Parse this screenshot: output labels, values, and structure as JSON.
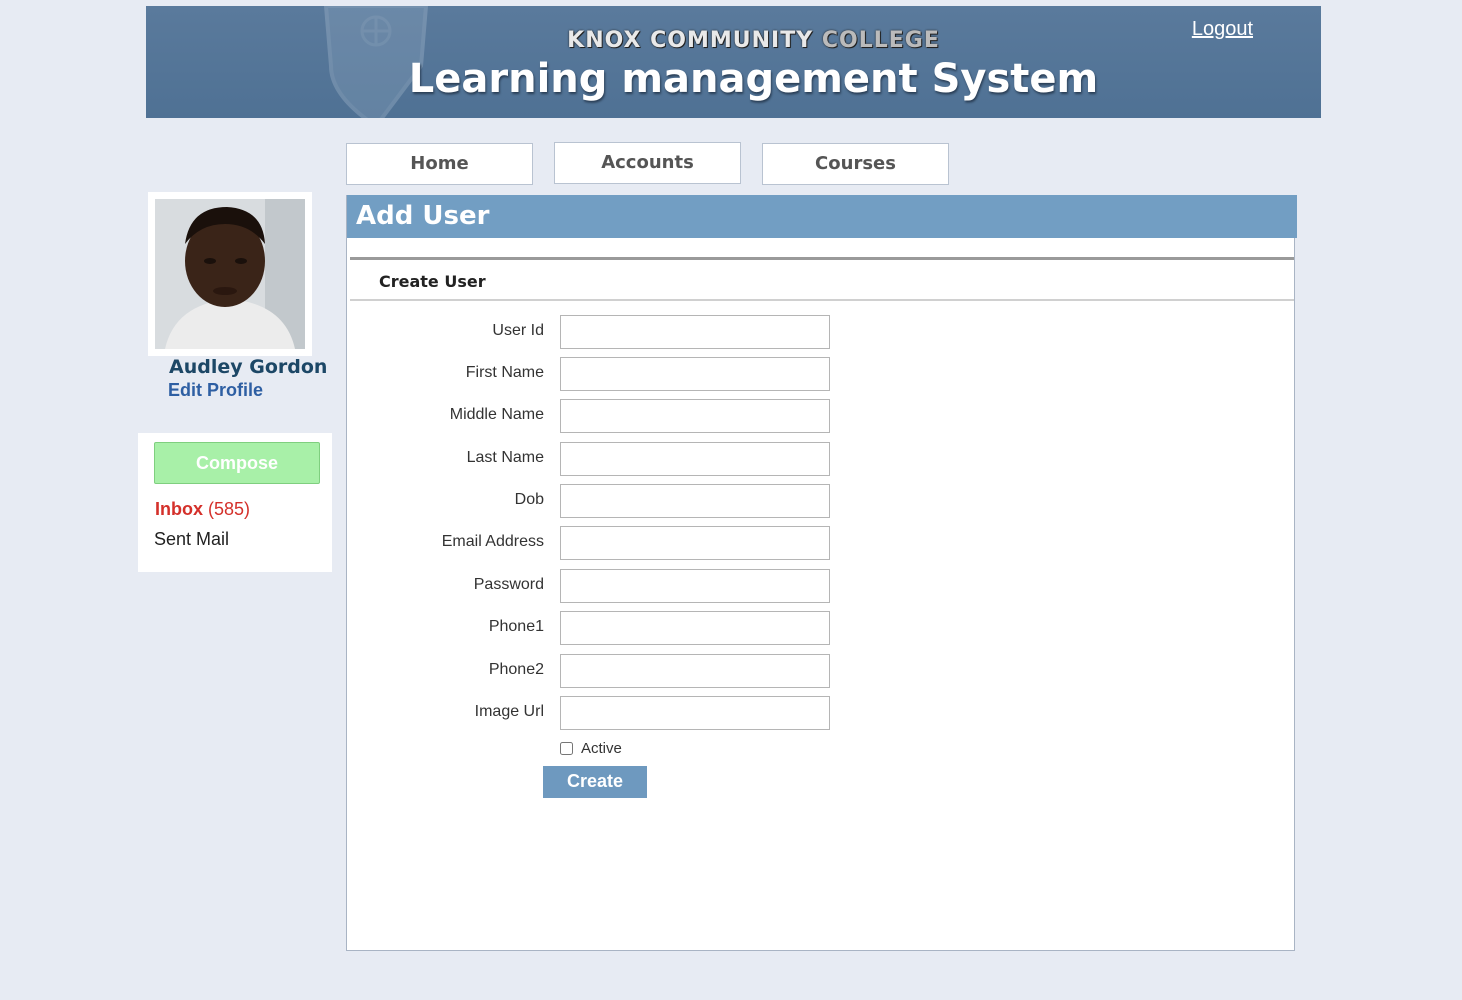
{
  "header": {
    "college_name_part1": "KNOX COMMUNITY ",
    "college_name_part2": "COLLEGE",
    "system_title": "Learning management System",
    "logout_label": "Logout"
  },
  "nav": {
    "home": "Home",
    "accounts": "Accounts",
    "courses": "Courses"
  },
  "profile": {
    "name": "Audley Gordon",
    "edit_label": "Edit Profile"
  },
  "mail": {
    "compose_label": "Compose",
    "inbox_label": "Inbox",
    "inbox_count": "(585)",
    "sent_label": "Sent Mail"
  },
  "panel": {
    "title": "Add User",
    "section_title": "Create User"
  },
  "form": {
    "fields": [
      {
        "label": "User Id",
        "value": ""
      },
      {
        "label": "First Name",
        "value": ""
      },
      {
        "label": "Middle Name",
        "value": ""
      },
      {
        "label": "Last Name",
        "value": ""
      },
      {
        "label": "Dob",
        "value": ""
      },
      {
        "label": "Email Address",
        "value": ""
      },
      {
        "label": "Password",
        "value": ""
      },
      {
        "label": "Phone1",
        "value": ""
      },
      {
        "label": "Phone2",
        "value": ""
      },
      {
        "label": "Image Url",
        "value": ""
      }
    ],
    "active_label": "Active",
    "active_checked": false,
    "submit_label": "Create"
  },
  "colors": {
    "banner": "#4f7194",
    "title_bar": "#729ec3",
    "compose": "#a8f0a8",
    "inbox": "#d4302a",
    "create_button": "#6e99bf"
  }
}
